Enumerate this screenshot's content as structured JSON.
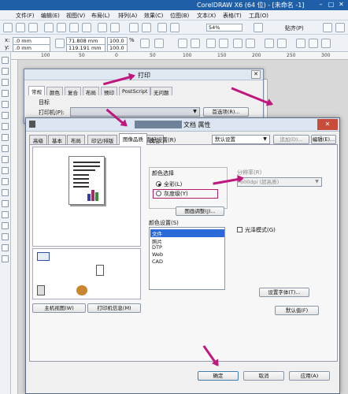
{
  "app": {
    "title": "CorelDRAW X6 (64 位) - [未命名 -1]"
  },
  "menu": [
    "文件(F)",
    "编辑(E)",
    "视图(V)",
    "布局(L)",
    "排列(A)",
    "效果(C)",
    "位图(B)",
    "文本(X)",
    "表格(T)",
    "工具(O)"
  ],
  "toolbar": {
    "zoom": "54%",
    "snap": "贴齐(P)"
  },
  "propbar": {
    "x_label": "x:",
    "x_val": ".0 mm",
    "y_label": "y:",
    "y_val": ".0 mm",
    "w_val": "71.808 mm",
    "h_val": "119.191 mm",
    "scale_w": "100.0",
    "scale_h": "100.0",
    "pct": "%"
  },
  "ruler": {
    "ticks": [
      "100",
      "50",
      "0",
      "50",
      "100",
      "150",
      "200",
      "250",
      "300"
    ]
  },
  "print_dialog": {
    "title": "打印",
    "tabs": [
      "常规",
      "颜色",
      "复合",
      "布局",
      "预印",
      "PostScript",
      "无问题"
    ],
    "target_label": "目标",
    "printer_label": "打印机(P):",
    "pref_button": "首选项(R)..."
  },
  "props_dialog": {
    "title": "文档 属性",
    "tabs": [
      "高级",
      "基本",
      "布局",
      "印记/排版",
      "图像品质",
      "其它"
    ],
    "pref_label": "喜好设置(R)",
    "pref_value": "默认设置",
    "add_button": "追加(D)...",
    "edit_button": "编辑(E)...",
    "color_group_label": "颜色选择",
    "radio_color": "全彩(L)",
    "radio_gray": "灰度级(Y)",
    "resolution_label": "分辨率(R)",
    "resolution_value": "600dpi (超高质)",
    "image_adjust_button": "图画调整(J)...",
    "color_settings_label": "颜色设置(S)",
    "color_list": [
      "文件",
      "照片",
      "DTP",
      "Web",
      "CAD"
    ],
    "gloss_label": "光泽模式(G)",
    "font_button": "设置字体(T)...",
    "default_button": "默认值(F)",
    "main_view_button": "主机视图(W)",
    "printer_info_button": "打印机信息(M)",
    "ok_button": "确定",
    "cancel_button": "取消",
    "apply_button": "应用(A)"
  },
  "colors": {
    "accent": "#c0177f",
    "selection": "#2a6ad8",
    "titlebar": "#1f5fa8"
  }
}
